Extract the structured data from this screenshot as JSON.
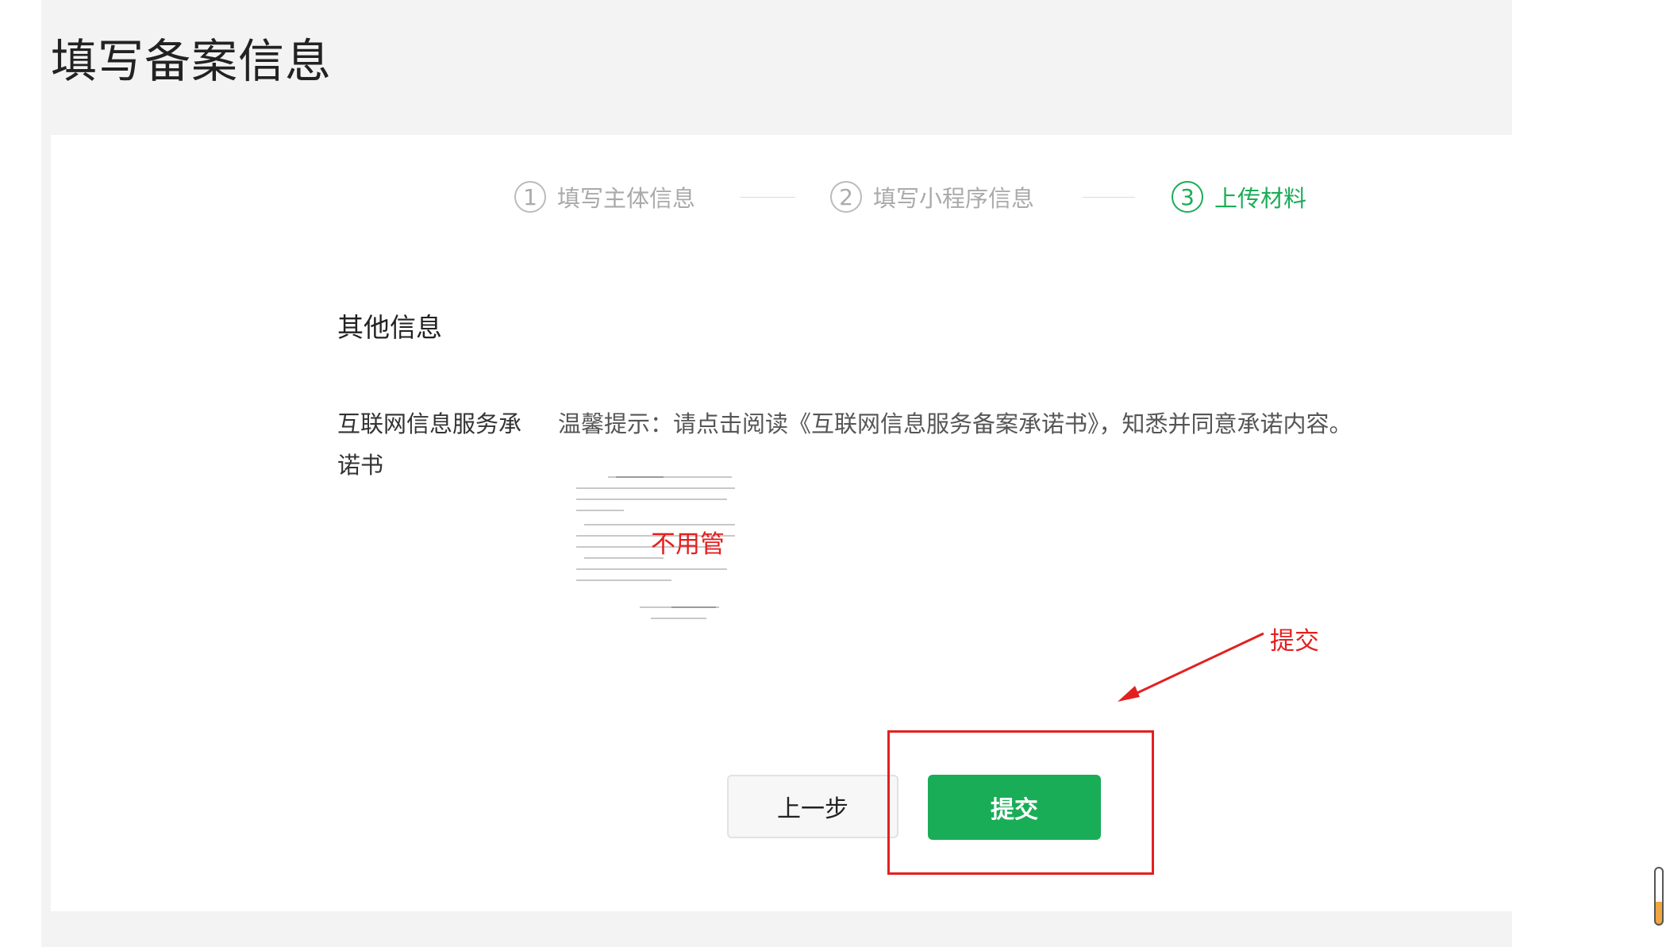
{
  "page": {
    "title": "填写备案信息"
  },
  "steps": [
    {
      "number": "1",
      "label": "填写主体信息",
      "active": false
    },
    {
      "number": "2",
      "label": "填写小程序信息",
      "active": false
    },
    {
      "number": "3",
      "label": "上传材料",
      "active": true
    }
  ],
  "section": {
    "title": "其他信息",
    "field_label": "互联网信息服务承诺书",
    "tip": "温馨提示：请点击阅读《互联网信息服务备案承诺书》，知悉并同意承诺内容。"
  },
  "annotations": {
    "ignore_note": "不用管",
    "arrow_label": "提交"
  },
  "buttons": {
    "prev_label": "上一步",
    "submit_label": "提交"
  },
  "colors": {
    "accent": "#1aad57",
    "annotation": "#e32020"
  }
}
